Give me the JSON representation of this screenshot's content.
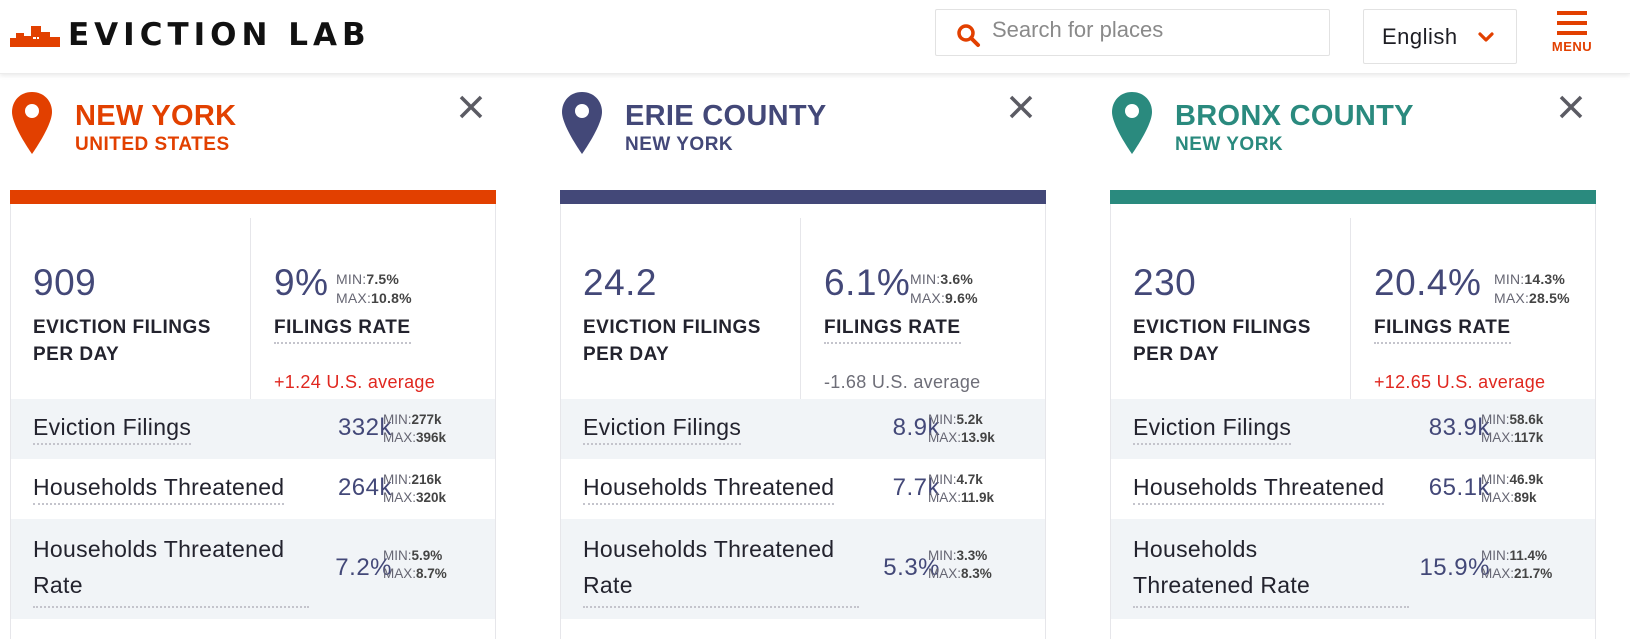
{
  "header": {
    "logo_text": "EVICTION LAB",
    "search_placeholder": "Search for places",
    "language": "English",
    "menu_label": "MENU",
    "brand_color": "#e24000"
  },
  "cards": [
    {
      "name": "NEW YORK",
      "sub": "UNITED STATES",
      "color": "#e24000",
      "filings_per_day": "909",
      "filings_per_day_label_1": "EVICTION FILINGS",
      "filings_per_day_label_2": "PER DAY",
      "filings_rate": "9%",
      "filings_rate_label": "FILINGS RATE",
      "rate_min": "7.5%",
      "rate_max": "10.8%",
      "vs_avg": "+1.24 U.S. average",
      "rows": [
        {
          "label": "Eviction Filings",
          "value": "332k",
          "min": "277k",
          "max": "396k"
        },
        {
          "label": "Households Threatened",
          "value": "264k",
          "min": "216k",
          "max": "320k"
        },
        {
          "label_1": "Households Threatened",
          "label_2": "Rate",
          "value": "7.2%",
          "min": "5.9%",
          "max": "8.7%"
        }
      ]
    },
    {
      "name": "ERIE COUNTY",
      "sub": "NEW YORK",
      "color": "#434878",
      "filings_per_day": "24.2",
      "filings_per_day_label_1": "EVICTION FILINGS",
      "filings_per_day_label_2": "PER DAY",
      "filings_rate": "6.1%",
      "filings_rate_label": "FILINGS RATE",
      "rate_min": "3.6%",
      "rate_max": "9.6%",
      "vs_avg": "-1.68 U.S. average",
      "rows": [
        {
          "label": "Eviction Filings",
          "value": "8.9k",
          "min": "5.2k",
          "max": "13.9k"
        },
        {
          "label": "Households Threatened",
          "value": "7.7k",
          "min": "4.7k",
          "max": "11.9k"
        },
        {
          "label_1": "Households Threatened",
          "label_2": "Rate",
          "value": "5.3%",
          "min": "3.3%",
          "max": "8.3%"
        }
      ]
    },
    {
      "name": "BRONX COUNTY",
      "sub": "NEW YORK",
      "color": "#2a8a7e",
      "filings_per_day": "230",
      "filings_per_day_label_1": "EVICTION FILINGS",
      "filings_per_day_label_2": "PER DAY",
      "filings_rate": "20.4%",
      "filings_rate_label": "FILINGS RATE",
      "rate_min": "14.3%",
      "rate_max": "28.5%",
      "vs_avg": "+12.65 U.S. average",
      "rows": [
        {
          "label": "Eviction Filings",
          "value": "83.9k",
          "min": "58.6k",
          "max": "117k"
        },
        {
          "label": "Households Threatened",
          "value": "65.1k",
          "min": "46.9k",
          "max": "89k"
        },
        {
          "label_1": "Households",
          "label_2": "Threatened Rate",
          "value": "15.9%",
          "min": "11.4%",
          "max": "21.7%"
        }
      ]
    }
  ],
  "labels": {
    "min": "MIN:",
    "max": "MAX:"
  },
  "icons": {
    "search": "search-icon",
    "chevron": "chevron-down-icon",
    "menu": "hamburger-icon",
    "pin": "map-pin-icon",
    "close": "close-icon"
  }
}
